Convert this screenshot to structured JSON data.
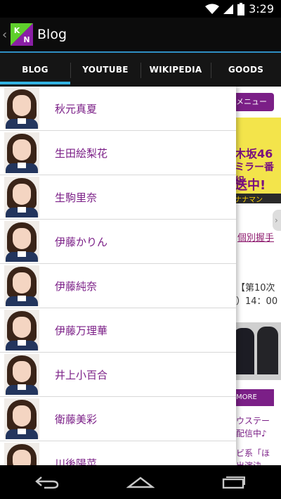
{
  "status_bar": {
    "time": "3:29",
    "icons": [
      "wifi-icon",
      "signal-icon",
      "battery-icon"
    ]
  },
  "action_bar": {
    "title": "Blog",
    "logo_letters": [
      "K",
      "N"
    ]
  },
  "tabs": [
    {
      "label": "BLOG",
      "active": true
    },
    {
      "label": "YOUTUBE",
      "active": false
    },
    {
      "label": "WIKIPEDIA",
      "active": false
    },
    {
      "label": "GOODS",
      "active": false
    }
  ],
  "members": [
    {
      "name": "秋元真夏"
    },
    {
      "name": "生田絵梨花"
    },
    {
      "name": "生駒里奈"
    },
    {
      "name": "伊藤かりん"
    },
    {
      "name": "伊藤純奈"
    },
    {
      "name": "伊藤万理華"
    },
    {
      "name": "井上小百合"
    },
    {
      "name": "衛藤美彩"
    },
    {
      "name": "川後陽菜"
    }
  ],
  "background_page": {
    "menu_button": "メニュー",
    "banner_line1": "木坂46",
    "banner_line2": "ミラー番組",
    "banner_line3": "送中!",
    "banner_line4": "ナナマン",
    "link": "個別握手",
    "text1": "【第10次",
    "text2": "）14：00",
    "more_button": "MORE",
    "text3": "ウステー",
    "text4": "配信中♪",
    "text5": "ビ系「ほ",
    "text6": "出演決"
  },
  "nav_bar": {
    "buttons": [
      "back-icon",
      "home-icon",
      "recent-apps-icon"
    ]
  },
  "colors": {
    "accent": "#33b5e5",
    "member_name": "#7b1f87",
    "logo_green": "#5fcf2c",
    "logo_purple": "#8a1fa6"
  }
}
